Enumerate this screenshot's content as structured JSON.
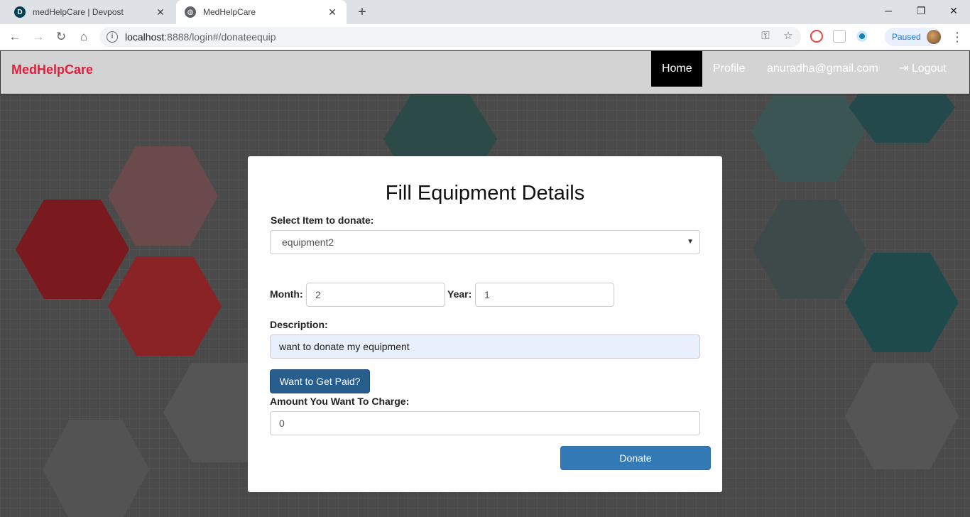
{
  "browser": {
    "tabs": [
      {
        "title": "medHelpCare | Devpost",
        "favicon": "D"
      },
      {
        "title": "MedHelpCare"
      }
    ],
    "url_host": "localhost",
    "url_path": ":8888/login#/donateequip",
    "profile_status": "Paused"
  },
  "navbar": {
    "brand": "MedHelpCare",
    "links": {
      "home": "Home",
      "profile": "Profile",
      "email": "anuradha@gmail.com",
      "logout": "Logout"
    }
  },
  "form": {
    "title": "Fill Equipment Details",
    "item_label": "Select Item to donate:",
    "item_value": "equipment2",
    "month_label": "Month:",
    "month_value": "2",
    "year_label": "Year:",
    "year_value": "1",
    "description_label": "Description:",
    "description_value": "want to donate my equipment",
    "paid_button": "Want to Get Paid?",
    "amount_label": "Amount You Want To Charge:",
    "amount_value": "0",
    "donate_button": "Donate"
  },
  "colors": {
    "brand": "#d9213d",
    "primary": "#337ab7",
    "primary_dark": "#285e8e"
  }
}
